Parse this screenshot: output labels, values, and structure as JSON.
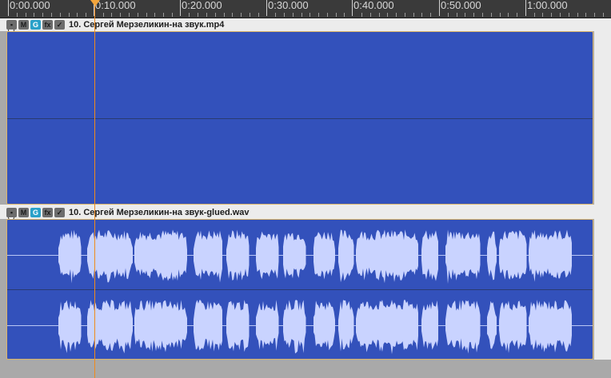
{
  "ruler": {
    "labels": [
      "0:00.000",
      "0:10.000",
      "0:20.000",
      "0:30.000",
      "0:40.000",
      "0:50.000",
      "1:00.000"
    ]
  },
  "items": [
    {
      "name": "10. Сергей Мерзеликин-на звук.mp4",
      "buttons": [
        "lock",
        "M",
        "G",
        "FX",
        "envelope"
      ],
      "button_glyphs": [
        "▪",
        "M",
        "G",
        "fx",
        "✓"
      ]
    },
    {
      "name": "10. Сергей Мерзеликин-на звук-glued.wav",
      "buttons": [
        "lock",
        "M",
        "G",
        "FX",
        "envelope"
      ],
      "button_glyphs": [
        "▪",
        "M",
        "G",
        "fx",
        "✓"
      ]
    }
  ],
  "colors": {
    "item_fill": "#3351bb",
    "waveform": "#c9d3ff",
    "playhead": "#f08a1c",
    "ruler_bg": "#3a3a3a",
    "group_button": "#2aa1c9"
  }
}
